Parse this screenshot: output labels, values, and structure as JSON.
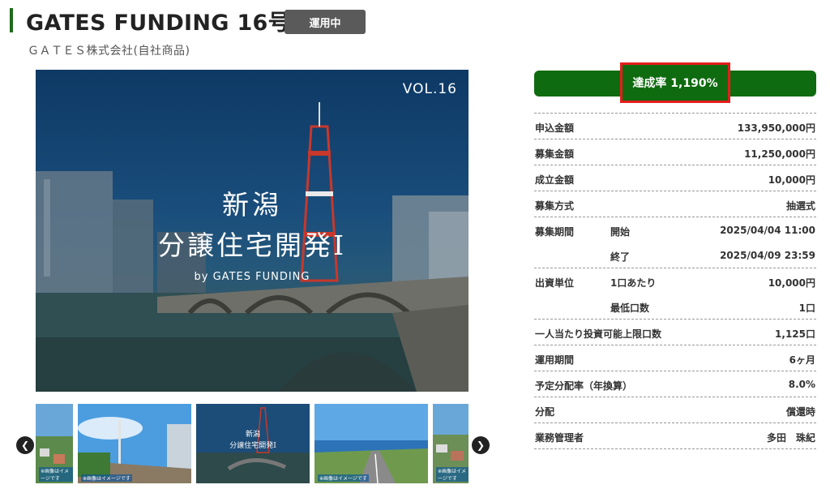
{
  "header": {
    "title": "GATES FUNDING 16号",
    "status": "運用中",
    "company": "ＧＡＴＥＳ株式会社(自社商品)"
  },
  "hero": {
    "vol": "VOL.16",
    "line1": "新潟",
    "line2": "分譲住宅開発Ⅰ",
    "by": "by GATES FUNDING"
  },
  "thumbnails": {
    "thumb3_line1": "新潟",
    "thumb3_line2": "分譲住宅開発Ⅰ",
    "tag": "※画像はイメージです"
  },
  "achievement": {
    "label": "達成率 1,190%"
  },
  "details": [
    {
      "label": "申込金額",
      "sub": "",
      "value": "133,950,000円"
    },
    {
      "label": "募集金額",
      "sub": "",
      "value": "11,250,000円"
    },
    {
      "label": "成立金額",
      "sub": "",
      "value": "10,000円"
    },
    {
      "label": "募集方式",
      "sub": "",
      "value": "抽選式"
    },
    {
      "label": "募集期間",
      "sub": "開始",
      "value": "2025/04/04 11:00"
    },
    {
      "label": "",
      "sub": "終了",
      "value": "2025/04/09 23:59"
    },
    {
      "label": "出資単位",
      "sub": "1口あたり",
      "value": "10,000円"
    },
    {
      "label": "",
      "sub": "最低口数",
      "value": "1口"
    },
    {
      "label": "一人当たり投資可能上限口数",
      "sub": "",
      "value": "1,125口"
    },
    {
      "label": "運用期間",
      "sub": "",
      "value": "6ヶ月"
    },
    {
      "label": "予定分配率（年換算）",
      "sub": "",
      "value": "8.0%"
    },
    {
      "label": "分配",
      "sub": "",
      "value": "償還時"
    },
    {
      "label": "業務管理者",
      "sub": "",
      "value": "多田　珠紀"
    }
  ],
  "icons": {
    "prev": "chevron-left-icon",
    "next": "chevron-right-icon"
  },
  "colors": {
    "accent": "#0f6b0f",
    "highlight": "#e51d1d",
    "badge": "#5a5a5a"
  }
}
